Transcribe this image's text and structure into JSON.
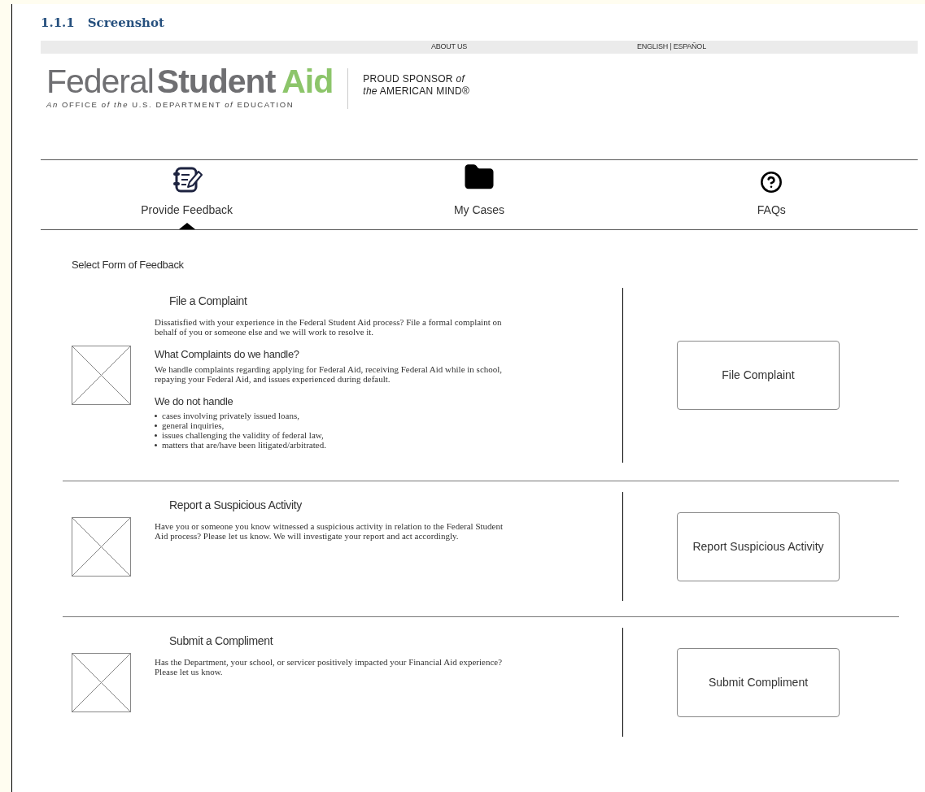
{
  "document": {
    "heading_number": "1.1.1",
    "heading": "Screenshot"
  },
  "top_bar": {
    "links": [
      {
        "label": "ABOUT US"
      },
      {
        "label": "ENGLISH | ESPAÑOL"
      }
    ]
  },
  "logo": {
    "word_1": "Federal",
    "word_2": "Student",
    "word_3": "Aid",
    "tagline": "*An* OFFICE *of the* U.S. DEPARTMENT *of* EDUCATION",
    "sponsor_lines": [
      "PROUD SPONSOR *of*",
      "*the* AMERICAN MIND®"
    ]
  },
  "tabs": [
    {
      "label": "Provide Feedback",
      "kind": "notepad",
      "selected": true
    },
    {
      "label": "My Cases",
      "kind": "folder",
      "selected": false
    },
    {
      "label": "FAQs",
      "kind": "question",
      "selected": false
    }
  ],
  "prompt": "Select Form of Feedback",
  "sections": [
    {
      "title": "File a Complaint",
      "button": "File Complaint",
      "blocks": [
        {
          "kind": "paragraph",
          "text": "Dissatisfied with your experience in the Federal Student Aid process? File a formal complaint on behalf of you or someone else and we will work to resolve it."
        },
        {
          "kind": "subheading",
          "text": "What Complaints do we handle?"
        },
        {
          "kind": "paragraph",
          "text": "We handle complaints regarding applying for Federal Aid, receiving Federal Aid while in school, repaying your Federal Aid, and issues experienced during default."
        },
        {
          "kind": "subheading",
          "text": "We do not handle"
        },
        {
          "kind": "bullets",
          "items": [
            "cases involving privately issued loans,",
            "general inquiries,",
            "issues challenging the validity of federal law,",
            "matters that are/have been litigated/arbitrated."
          ]
        }
      ]
    },
    {
      "title": "Report a Suspicious Activity",
      "button": "Report Suspicious Activity",
      "blocks": [
        {
          "kind": "paragraph",
          "text": "Have you or someone you know witnessed a suspicious activity in relation to the Federal Student Aid process? Please let us know. We will investigate your report and act accordingly."
        }
      ]
    },
    {
      "title": "Submit a Compliment",
      "button": "Submit Compliment",
      "blocks": [
        {
          "kind": "paragraph",
          "text": "Has the Department, your school, or servicer positively impacted your Financial Aid experience? Please let us know."
        }
      ]
    }
  ]
}
